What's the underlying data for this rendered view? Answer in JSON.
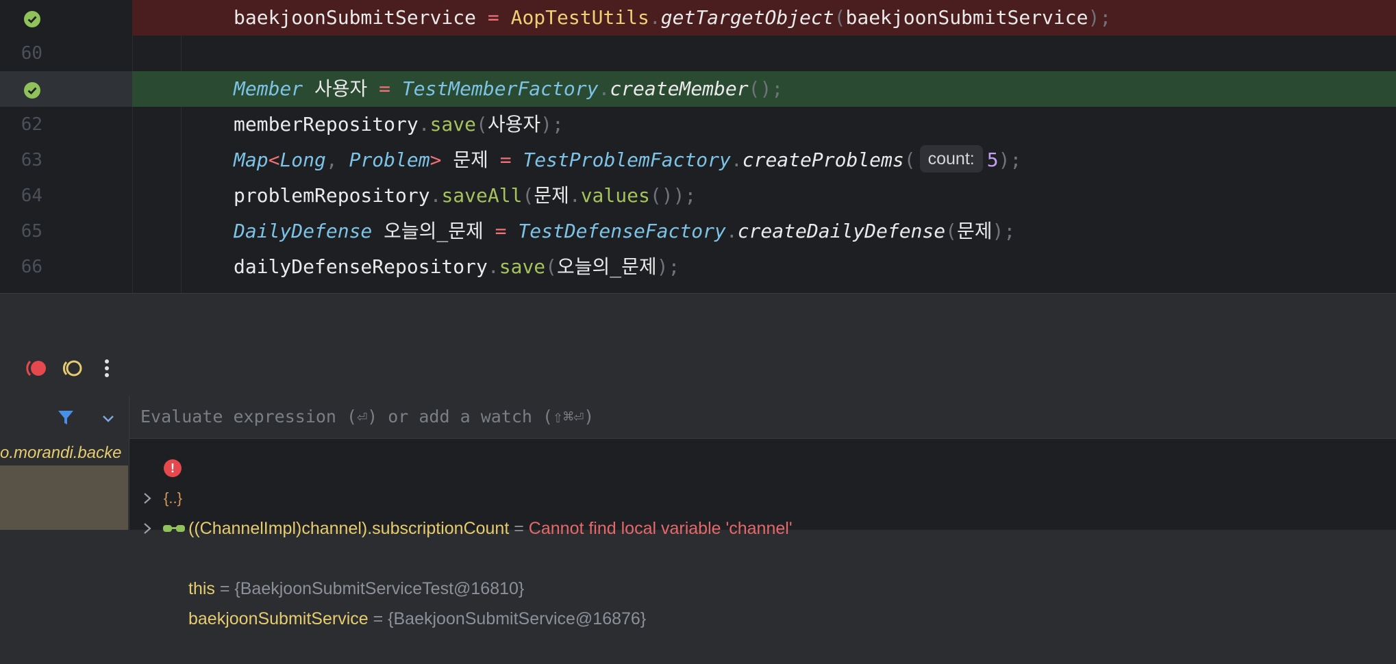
{
  "editor": {
    "lines": [
      {
        "number": "",
        "state": "breakpoint-failed",
        "tokens": [
          {
            "t": "baekjoonSubmitService",
            "c": "v"
          },
          {
            "t": " = ",
            "c": "op"
          },
          {
            "t": "AopTestUtils",
            "c": "gold"
          },
          {
            "t": ".",
            "c": "dot"
          },
          {
            "t": "getTargetObject",
            "c": "mth"
          },
          {
            "t": "(",
            "c": "punc"
          },
          {
            "t": "baekjoonSubmitService",
            "c": "v"
          },
          {
            "t": ");",
            "c": "punc"
          }
        ]
      },
      {
        "number": "60",
        "state": "normal",
        "tokens": []
      },
      {
        "number": "",
        "state": "breakpoint-current",
        "tokens": [
          {
            "t": "Member",
            "c": "cls"
          },
          {
            "t": " 사용자",
            "c": "v"
          },
          {
            "t": " = ",
            "c": "op"
          },
          {
            "t": "TestMemberFactory",
            "c": "cls"
          },
          {
            "t": ".",
            "c": "dot"
          },
          {
            "t": "createMember",
            "c": "mth"
          },
          {
            "t": "();",
            "c": "punc"
          }
        ]
      },
      {
        "number": "62",
        "state": "normal",
        "tokens": [
          {
            "t": "memberRepository",
            "c": "v"
          },
          {
            "t": ".",
            "c": "dot"
          },
          {
            "t": "save",
            "c": "grn"
          },
          {
            "t": "(",
            "c": "punc"
          },
          {
            "t": "사용자",
            "c": "v"
          },
          {
            "t": ");",
            "c": "punc"
          }
        ]
      },
      {
        "number": "63",
        "state": "normal",
        "tokens": [
          {
            "t": "Map",
            "c": "cls"
          },
          {
            "t": "<",
            "c": "op"
          },
          {
            "t": "Long",
            "c": "cls"
          },
          {
            "t": ", ",
            "c": "punc"
          },
          {
            "t": "Problem",
            "c": "cls"
          },
          {
            "t": ">",
            "c": "op"
          },
          {
            "t": " 문제",
            "c": "v"
          },
          {
            "t": " = ",
            "c": "op"
          },
          {
            "t": "TestProblemFactory",
            "c": "cls"
          },
          {
            "t": ".",
            "c": "dot"
          },
          {
            "t": "createProblems",
            "c": "mth"
          },
          {
            "t": "(",
            "c": "punc"
          },
          {
            "t": "count:",
            "c": "hint"
          },
          {
            "t": "5",
            "c": "num"
          },
          {
            "t": ");",
            "c": "punc"
          }
        ]
      },
      {
        "number": "64",
        "state": "normal",
        "tokens": [
          {
            "t": "problemRepository",
            "c": "v"
          },
          {
            "t": ".",
            "c": "dot"
          },
          {
            "t": "saveAll",
            "c": "grn"
          },
          {
            "t": "(",
            "c": "punc"
          },
          {
            "t": "문제",
            "c": "v"
          },
          {
            "t": ".",
            "c": "dot"
          },
          {
            "t": "values",
            "c": "grn"
          },
          {
            "t": "());",
            "c": "punc"
          }
        ]
      },
      {
        "number": "65",
        "state": "normal",
        "tokens": [
          {
            "t": "DailyDefense",
            "c": "cls"
          },
          {
            "t": " 오늘의_문제",
            "c": "v"
          },
          {
            "t": " = ",
            "c": "op"
          },
          {
            "t": "TestDefenseFactory",
            "c": "cls"
          },
          {
            "t": ".",
            "c": "dot"
          },
          {
            "t": "createDailyDefense",
            "c": "mth"
          },
          {
            "t": "(",
            "c": "punc"
          },
          {
            "t": "문제",
            "c": "v"
          },
          {
            "t": ");",
            "c": "punc"
          }
        ]
      },
      {
        "number": "66",
        "state": "normal",
        "tokens": [
          {
            "t": "dailyDefenseRepository",
            "c": "v"
          },
          {
            "t": ".",
            "c": "dot"
          },
          {
            "t": "save",
            "c": "grn"
          },
          {
            "t": "(",
            "c": "punc"
          },
          {
            "t": "오늘의_문제",
            "c": "v"
          },
          {
            "t": ");",
            "c": "punc"
          }
        ]
      }
    ]
  },
  "debugger": {
    "frames_item": "o.morandi.backe",
    "evaluate_placeholder": "Evaluate expression (⏎) or add a watch (⇧⌘⏎)",
    "variables": [
      {
        "kind": "error",
        "name": "((ChannelImpl)channel).subscriptionCount",
        "eq": " = ",
        "value": "Cannot find local variable 'channel'"
      },
      {
        "kind": "object",
        "name": "this",
        "eq": " = ",
        "value": "{BaekjoonSubmitServiceTest@16810}"
      },
      {
        "kind": "watch",
        "name": "baekjoonSubmitService",
        "eq": " = ",
        "value": "{BaekjoonSubmitService@16876}"
      }
    ]
  },
  "colors": {
    "breakpoint_failed": "#4a1d1f",
    "current_line": "#2a4a31",
    "check": "#8fc25a",
    "error": "#e5484d"
  }
}
